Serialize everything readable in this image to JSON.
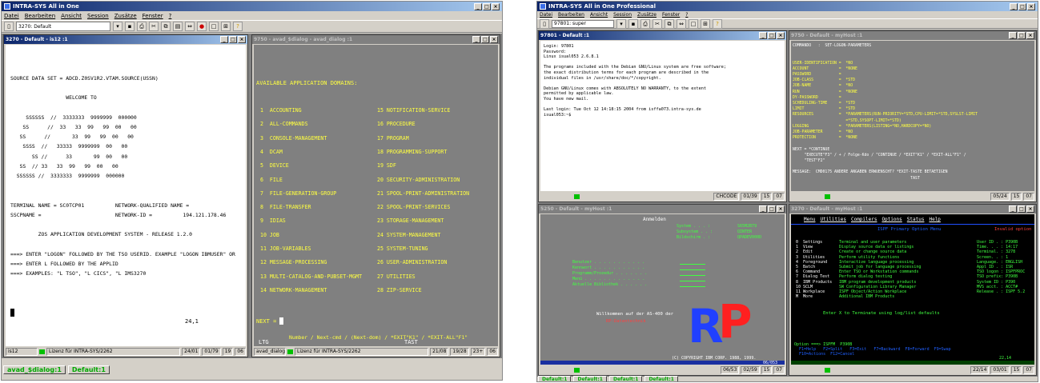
{
  "left": {
    "title": "INTRA-SYS All in One",
    "menu": [
      "Datei",
      "Bearbeiten",
      "Ansicht",
      "Session",
      "Zusätze",
      "Fenster",
      "?"
    ],
    "session_select": "3270: Default",
    "taskbar": [
      "avad_$dialog:1",
      "Default:1"
    ],
    "w1": {
      "title": "3270 - Default - is12 :1",
      "lines": [
        "SOURCE DATA SET = ADCD.Z0SV1R2.VTAM.SOURCE(USSN)",
        "",
        "                  WELCOME TO",
        "",
        "     SSSSSS  //  3333333  9999999  000000",
        "    SS      //  33   33  99   99  00   00",
        "   SS      //       33  99   99  00   00",
        "    SSSS  //   33333  9999999  00   00",
        "       SS //      33       99  00   00",
        "   SS  // 33   33  99   99  00   00",
        "  SSSSSS //  3333333  9999999  000000",
        "",
        "",
        "TERMINAL NAME = SC0TCP01          NETWORK-QUALIFIED NAME =",
        "SSCPNAME =                        NETWORK-ID =          194.121.178.46",
        "",
        "         ZOS APPLICATION DEVELOPMENT SYSTEM - RELEASE 1.2.0",
        "",
        "===> ENTER \"LOGON\" FOLLOWED BY THE TSO USERID. EXAMPLE \"LOGON IBMUSER\" OR",
        "===> ENTER L FOLLOWED BY THE APPLID",
        "===> EXAMPLES: \"L TSO\", \"L CICS\", \"L IMS3270"
      ],
      "cursor": "24,1",
      "status": [
        "is12",
        "Lizenz für INTRA-SYS/2262",
        "24/01",
        "01/79",
        "19",
        "06"
      ]
    },
    "w2": {
      "title": "9750 - avad_$dialog - avad_dialog :1",
      "header": "AVAILABLE APPLICATION DOMAINS:",
      "col1": [
        "1  ACCOUNTING",
        "2  ALL-COMMANDS",
        "3  CONSOLE-MANAGEMENT",
        "4  DCAM",
        "5  DEVICE",
        "6  FILE",
        "7  FILE-GENERATION-GROUP",
        "8  FILE-TRANSFER",
        "9  IDIAS",
        "10 JOB",
        "11 JOB-VARIABLES",
        "12 MESSAGE-PROCESSING",
        "13 MULTI-CATALOG-AND-PUBSET-MGMT",
        "14 NETWORK-MANAGEMENT"
      ],
      "col2": [
        "15 NOTIFICATION-SERVICE",
        "16 PROCEDURE",
        "17 PROGRAM",
        "18 PROGRAMMING-SUPPORT",
        "19 SDF",
        "20 SECURITY-ADMINISTRATION",
        "21 SPOOL-PRINT-ADMINISTRATION",
        "22 SPOOL-PRINT-SERVICES",
        "23 STORAGE-MANAGEMENT",
        "24 SYSTEM-MANAGEMENT",
        "25 SYSTEM-TUNING",
        "26 USER-ADMINISTRATION",
        "27 UTILITIES",
        "28 ZIP-SERVICE"
      ],
      "next": "NEXT = ",
      "hint": "Number / Next-cmd / (Next-dom) / *EXIT\"K1\" / *EXIT-ALL\"F1\"",
      "ltg": "LTG",
      "tast": "TAST",
      "status": [
        "avad_dialog",
        "Lizenz für INTRA-SYS/2262",
        "21/08",
        "19/28",
        "23+",
        "06"
      ]
    }
  },
  "right": {
    "title": "INTRA-SYS All in One Professional",
    "menu": [
      "Datei",
      "Bearbeiten",
      "Ansicht",
      "Session",
      "Zusätze",
      "Fenster",
      "?"
    ],
    "session_select": "97801: super",
    "taskbar": [
      "Default:1",
      "Default:1",
      "Default:1",
      "Default:1"
    ],
    "w1": {
      "title": "97801 - Default :1",
      "lines": [
        "Login: 97801",
        "Password:",
        "Linux isual053 2.6.8.1",
        "",
        "The programs included with the Debian GNU/Linux system are free software;",
        "the exact distribution terms for each program are described in the",
        "individual files in /usr/share/doc/*/copyright.",
        "",
        "Debian GNU/Linux comes with ABSOLUTELY NO WARRANTY, to the extent",
        "permitted by applicable law.",
        "You have new mail.",
        "",
        "Last login: Tue Oct 12 14:18:15 2004 from isffa073.intra-sys.de",
        "isual053:~$"
      ],
      "status": [
        "CHCODE",
        "01/39",
        "15",
        "07"
      ]
    },
    "w2": {
      "title": "9750 - Default - myHost :1",
      "lines": [
        "COMMANDO   :  SET-LOGON-PARAMETERS",
        "",
        "",
        "USER-IDENTIFICATION =  *NO",
        "ACCOUNT             =  *NONE",
        "PASSWORD            =",
        "JOB-CLASS           =  *STD",
        "JOB-NAME            =  *NO",
        "RUN                 =  *NONE",
        "DY-PASSWORD         =",
        "SCHEDULING-TIME     =  *STD",
        "LIMIT               =  *STD",
        "RESOURCES           =  *PARAMETERS(RUN-PRIORITY=*STD,CPU-LIMIT=*STD,SYSLST-LIMIT",
        "                       =*STD,SYSOPT-LIMIT=*STD)",
        "LOGGING             =  *PARAMETERS(LISTING=*NO,HARDCOPY=*NO)",
        "JOB-PARAMETER       =  *NO",
        "PROTECTION          =  *NONE",
        "",
        "NEXT = *CONTINUE",
        "     \"EXECUTE\"F3\" / + / Folge-Kdo / \"CONTINUE / *EXIT\"K1\" / *EXIT-ALL\"F1\" /",
        "     \"TEST\"F2\"",
        "",
        "MESSAGE:  CMD0175 ANDERE ANGABEN ERWUENSCHT? *EXIT-TASTE BETAETIGEN",
        "                                                   TAST"
      ],
      "status": [
        "05/24",
        "15",
        "07"
      ]
    },
    "w3": {
      "title": "5250 - Default - myHost :1",
      "heading": "Anmelden",
      "sys": [
        "System . . . :",
        "Subsystem . . :",
        "Bildschirm . :"
      ],
      "sysv": [
        "S65M2B79",
        "QINTER",
        "QPADEV000D"
      ],
      "fields": [
        "Benutzer . . . . . . . . . . .",
        "Kennwort . . . . . . . . . . .",
        "Programm/Prozedur . . . . . . .",
        "Menü . . . . . . . . . . . . .",
        "Aktuelle Bibliothek . . . . . ."
      ],
      "welcome": "Willkommen auf der AS-400 der",
      "company": "RP-Datentechnik",
      "logo": [
        "R",
        "P"
      ],
      "copyright": "(C) COPYRIGHT IBM CORP. 1988, 1999.",
      "pos": "06/053",
      "status": [
        "06/53",
        "02/59",
        "15",
        "07"
      ]
    },
    "w4": {
      "title": "3270 - Default - myHost :1",
      "menu": [
        "Menu",
        "Utilities",
        "Compilers",
        "Options",
        "Status",
        "Help"
      ],
      "heading": "ISPF Primary Option Menu",
      "invalid": "Invalid option",
      "opts": [
        "0  Settings",
        "1  View",
        "2  Edit",
        "3  Utilities",
        "4  Foreground",
        "5  Batch",
        "6  Command",
        "7  Dialog Test",
        "8  IBM Products",
        "10 SCLM",
        "11 Workplace",
        "M  More"
      ],
      "descs": [
        "Terminal and user parameters",
        "Display source data or listings",
        "Create or change source data",
        "Perform utility functions",
        "Interactive language processing",
        "Submit job for language processing",
        "Enter TSO or Workstation commands",
        "Perform dialog testing",
        "IBM program development products",
        "SW Configuration Library Manager",
        "ISPF Object/Action Workplace",
        "Additional IBM Products"
      ],
      "info": [
        "User ID . : P390B",
        "Time. . . : 14:17",
        "Terminal. : 3278",
        "Screen. . : 1",
        "Language. : ENGLISH",
        "Appl ID . : ISR",
        "TSO logon : ISPFPROC",
        "TSO prefix: P390B",
        "System ID : P390",
        "MVS acct. : ACCT#",
        "Release . : ISPF 5.2"
      ],
      "terminate": "Enter X to Terminate using log/list defaults",
      "option": "Option ===> ISPFM  P390B",
      "fkeys1": "  F1=Help   F2=Split   F3=Exit   F7=Backward  F8=Forward  F9=Swap",
      "fkeys2": "  F10=Actions  F12=Cancel",
      "pos": "22,14",
      "status": [
        "22/14",
        "03/01",
        "15",
        "07"
      ]
    }
  }
}
